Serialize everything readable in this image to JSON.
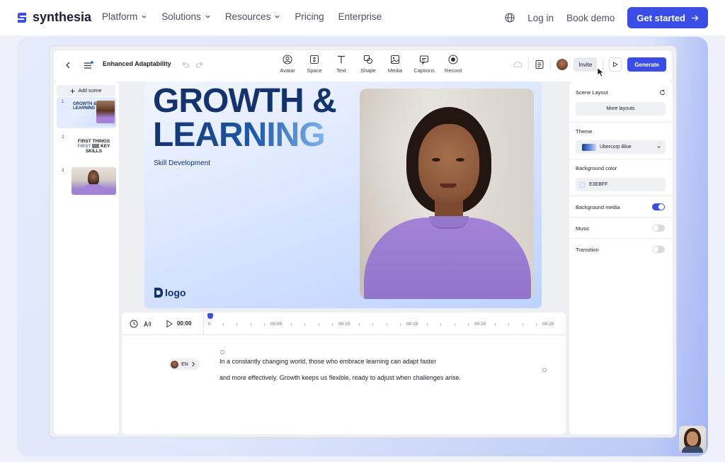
{
  "nav": {
    "brand": "synthesia",
    "links": [
      "Platform",
      "Solutions",
      "Resources",
      "Pricing",
      "Enterprise"
    ],
    "login": "Log in",
    "book_demo": "Book demo",
    "cta": "Get started"
  },
  "editor": {
    "project_title": "Enhanced Adaptability",
    "tools": [
      "Avatar",
      "Space",
      "Text",
      "Shape",
      "Media",
      "Captions",
      "Record"
    ],
    "invite": "Invite",
    "generate": "Generate",
    "add_scene": "Add scene",
    "scenes": [
      {
        "num": "1",
        "title_line1": "GROWTH &",
        "title_line2": "LEARNING"
      },
      {
        "num": "2",
        "title_line1": "FIRST THINGS",
        "title_line2": "FIRST",
        "title_line3": "KEY",
        "title_line4": "SKILLS"
      },
      {
        "num": "3"
      }
    ],
    "canvas": {
      "title_line1": "GROWTH &",
      "title_line2": "LEARNING",
      "subtitle": "Skill Development",
      "logo_text": "logo"
    },
    "timeline": {
      "current_time": "00:00",
      "labels": [
        "0",
        "00:05",
        "00:10",
        "00:15",
        "00:20",
        "00:25"
      ]
    },
    "script": {
      "language": "EN",
      "line1": "In a constantly changing world, those who embrace learning can adapt faster",
      "line2": "and more effectively. Growth keeps us flexible, ready to adjust when challenges arise."
    },
    "panel": {
      "scene_layout": "Scene Layout",
      "more_layouts": "More layouts",
      "theme_label": "Theme",
      "theme_value": "Ubercorp Blue",
      "bg_color_label": "Background color",
      "bg_color_value": "E3EBFF",
      "bg_media_label": "Background media",
      "bg_media_on": true,
      "music_label": "Music",
      "music_on": false,
      "transition_label": "Transition",
      "transition_on": false
    }
  },
  "colors": {
    "accent": "#3a4de4",
    "title_navy": "#14326b",
    "canvas_bg": "#E3EBFF",
    "sweater": "#a283d8"
  }
}
